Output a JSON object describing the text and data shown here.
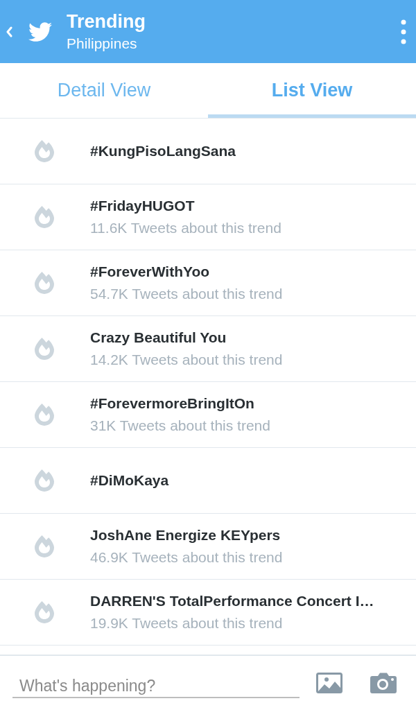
{
  "header": {
    "title": "Trending",
    "subtitle": "Philippines"
  },
  "tabs": [
    {
      "label": "Detail View",
      "selected": false
    },
    {
      "label": "List View",
      "selected": true
    }
  ],
  "trends": [
    {
      "name": "#KungPisoLangSana"
    },
    {
      "name": "#FridayHUGOT",
      "count": "11.6K Tweets about this trend"
    },
    {
      "name": "#ForeverWithYoo",
      "count": "54.7K Tweets about this trend"
    },
    {
      "name": "Crazy Beautiful You",
      "count": "14.2K Tweets about this trend"
    },
    {
      "name": "#ForevermoreBringItOn",
      "count": "31K Tweets about this trend"
    },
    {
      "name": "#DiMoKaya"
    },
    {
      "name": "JoshAne Energize KEYpers",
      "count": "46.9K Tweets about this trend"
    },
    {
      "name": "DARREN'S TotalPerformance Concert I…",
      "count": "19.9K Tweets about this trend"
    }
  ],
  "composer": {
    "placeholder": "What's happening?"
  }
}
